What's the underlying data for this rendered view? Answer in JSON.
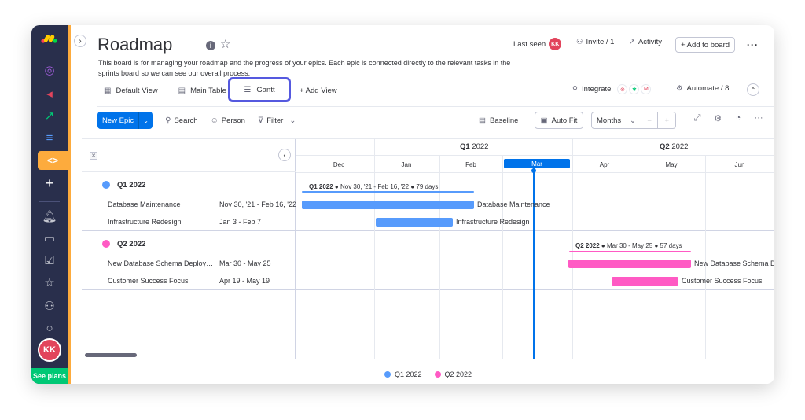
{
  "leftbar": {
    "avatar_initials": "KK",
    "plans_label": "See plans",
    "accent_color": "#fdab3d"
  },
  "board": {
    "title": "Roadmap",
    "description": "This board is for managing your roadmap and the progress of your epics. Each epic is connected directly to the relevant tasks in the sprints board so we can see our overall process.",
    "last_seen_label": "Last seen",
    "last_seen_avatar": "KK",
    "invite_label": "Invite / 1",
    "activity_label": "Activity",
    "add_to_board_label": "+ Add to board"
  },
  "tabs": [
    {
      "label": "Default View",
      "icon": "dashboard-icon"
    },
    {
      "label": "Main Table",
      "icon": "table-icon"
    },
    {
      "label": "Gantt",
      "icon": "gantt-icon",
      "active": true
    },
    {
      "label": "+ Add View",
      "icon": "plus-icon"
    }
  ],
  "integrations": {
    "integrate_label": "Integrate",
    "automate_label": "Automate / 8"
  },
  "toolbar": {
    "new_epic_label": "New Epic",
    "search_label": "Search",
    "person_label": "Person",
    "filter_label": "Filter",
    "baseline_label": "Baseline",
    "autofit_label": "Auto Fit",
    "zoom_select": "Months",
    "zoom_out": "−",
    "zoom_in": "+"
  },
  "timeline": {
    "quarters": [
      {
        "name": "Q1",
        "year": "2022"
      },
      {
        "name": "Q2",
        "year": "2022"
      }
    ],
    "months": [
      "Dec",
      "Jan",
      "Feb",
      "Mar",
      "Apr",
      "May",
      "Jun"
    ],
    "current_month": "Mar"
  },
  "groups": [
    {
      "name": "Q1 2022",
      "color": "#579bfc",
      "summary": {
        "name": "Q1 2022",
        "range": "Nov 30, '21 - Feb 16, '22",
        "duration": "79 days"
      },
      "items": [
        {
          "name": "Database Maintenance",
          "dates": "Nov 30, '21 - Feb 16, '22"
        },
        {
          "name": "Infrastructure Redesign",
          "dates": "Jan 3 - Feb 7"
        }
      ]
    },
    {
      "name": "Q2 2022",
      "color": "#ff5ac4",
      "summary": {
        "name": "Q2 2022",
        "range": "Mar 30 - May 25",
        "duration": "57 days"
      },
      "items": [
        {
          "name": "New Database Schema Deployment",
          "bar_label": "New Database Schema D",
          "dates": "Mar 30 - May 25"
        },
        {
          "name": "Customer Success Focus",
          "dates": "Apr 19 - May 19"
        }
      ]
    }
  ],
  "legend": [
    {
      "label": "Q1 2022",
      "color": "#579bfc"
    },
    {
      "label": "Q2 2022",
      "color": "#ff5ac4"
    }
  ]
}
